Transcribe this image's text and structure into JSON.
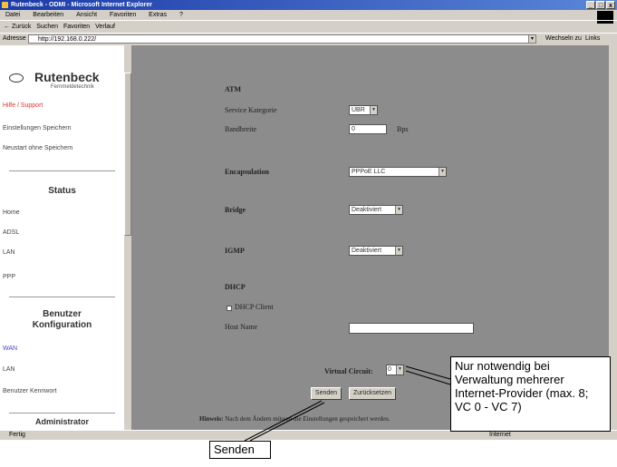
{
  "window": {
    "title": "Rutenbeck - ODMI - Microsoft Internet Explorer",
    "controls": [
      "_",
      "□",
      "x"
    ]
  },
  "menubar": [
    "Datei",
    "Bearbeiten",
    "Ansicht",
    "Favoriten",
    "Extras",
    "?"
  ],
  "toolbar": {
    "back": "← Zurück",
    "items": [
      "Suchen",
      "Favoriten",
      "Verlauf"
    ]
  },
  "address": {
    "label": "Adresse",
    "value": "http://192.168.0.222/",
    "go": "Wechseln zu",
    "links": "Links"
  },
  "sidebar": {
    "logo_name": "Rutenbeck",
    "logo_sub": "Fernmeldetechnik",
    "links_top": [
      "Hilfe / Support",
      "Einstellungen Speichern",
      "Neustart ohne Speichern"
    ],
    "status_head": "Status",
    "status_links": [
      "Home",
      "ADSL",
      "LAN",
      "PPP"
    ],
    "config_head1": "Benutzer",
    "config_head2": "Konfiguration",
    "config_links": [
      "WAN",
      "LAN",
      "Benutzer Kennwort"
    ],
    "admin_head": "Administrator"
  },
  "form": {
    "atm_label": "ATM",
    "service_label": "Service Kategorie",
    "service_value": "UBR",
    "bandwidth_label": "Bandbreite",
    "bandwidth_value": "0",
    "bandwidth_unit": "Bps",
    "encap_label": "Encapsulation",
    "encap_value": "PPPoE LLC",
    "bridge_label": "Bridge",
    "bridge_value": "Deaktiviert",
    "igmp_label": "IGMP",
    "igmp_value": "Deaktiviert",
    "dhcp_label": "DHCP",
    "dhcp_client_label": "DHCP Client",
    "hostname_label": "Host Name",
    "hostname_value": "",
    "vc_label": "Virtual Circuit:",
    "vc_value": "0",
    "send_button": "Senden",
    "reset_button": "Zurücksetzen",
    "hint_bold": "Hinweis:",
    "hint_text": "Nach dem Ändern müssen die Einstellungen gespeichert werden."
  },
  "annotations": {
    "vc_note": "Nur notwendig bei Verwaltung mehrerer Internet-Provider (max. 8; VC 0 - VC 7)",
    "send_note": "Senden"
  },
  "statusbar": {
    "status": "Fertig",
    "zone": "Internet"
  }
}
